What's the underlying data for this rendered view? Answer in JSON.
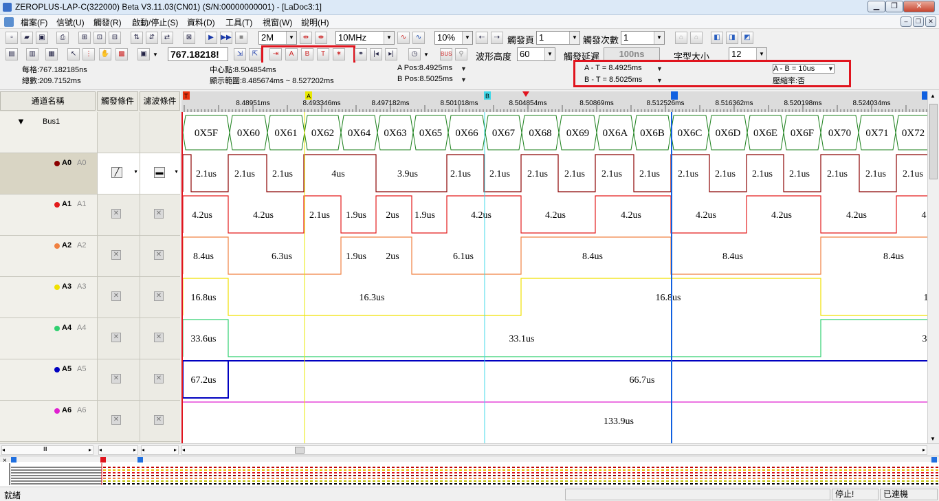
{
  "window": {
    "title": "ZEROPLUS-LAP-C(322000) Beta V3.11.03(CN01) (S/N:00000000001) - [LaDoc3:1]"
  },
  "menu": [
    "檔案(F)",
    "信號(U)",
    "觸發(R)",
    "啟動/停止(S)",
    "資料(D)",
    "工具(T)",
    "視窗(W)",
    "說明(H)"
  ],
  "toolbar": {
    "memory_depth": "2M",
    "sample_rate": "10MHz",
    "trigger_pos": "10%",
    "trigger_page_label": "觸發頁",
    "trigger_page": "1",
    "trigger_count_label": "觸發次數",
    "trigger_count": "1",
    "zoom_value": "767.18218!",
    "wave_height_label": "波形高度",
    "wave_height": "60",
    "trigger_delay_label": "觸發延遲",
    "trigger_delay": "100ns",
    "font_size_label": "字型大小",
    "font_size": "12"
  },
  "info": {
    "per_div": "每格:767.182185ns",
    "total": "總數:209.7152ms",
    "center": "中心點:8.504854ms",
    "range": "顯示範圍:8.485674ms ~ 8.527202ms",
    "a_pos": "A Pos:8.4925ms",
    "b_pos": "B Pos:8.5025ms",
    "a_minus_t": "A - T = 8.4925ms",
    "b_minus_t": "B - T = 8.5025ms",
    "a_minus_b": "A - B = 10us",
    "compress": "壓縮率:否"
  },
  "headers": {
    "channel_name": "通道名稱",
    "trigger_cond": "觸發條件",
    "filter_cond": "濾波條件"
  },
  "channels": [
    {
      "name": "Bus1",
      "alias": "",
      "color": "#000000"
    },
    {
      "name": "A0",
      "alias": "A0",
      "color": "#8b0000"
    },
    {
      "name": "A1",
      "alias": "A1",
      "color": "#e31b1b"
    },
    {
      "name": "A2",
      "alias": "A2",
      "color": "#f08040"
    },
    {
      "name": "A3",
      "alias": "A3",
      "color": "#f0e000"
    },
    {
      "name": "A4",
      "alias": "A4",
      "color": "#30d070"
    },
    {
      "name": "A5",
      "alias": "A5",
      "color": "#0000c0"
    },
    {
      "name": "A6",
      "alias": "A6",
      "color": "#e020d0"
    }
  ],
  "ruler": {
    "ticks": [
      "8.48951ms",
      "8.493346ms",
      "8.497182ms",
      "8.501018ms",
      "8.504854ms",
      "8.50869ms",
      "8.512526ms",
      "8.516362ms",
      "8.520198ms",
      "8.524034ms"
    ],
    "markers": [
      "A",
      "B"
    ]
  },
  "bus": [
    "0X5F",
    "0X60",
    "0X61",
    "0X62",
    "0X64",
    "0X63",
    "0X65",
    "0X66",
    "0X67",
    "0X68",
    "0X69",
    "0X6A",
    "0X6B",
    "0X6C",
    "0X6D",
    "0X6E",
    "0X6F",
    "0X70",
    "0X71",
    "0X72"
  ],
  "waves": [
    {
      "ch": "A0",
      "labels": [
        "2.1us",
        "2.1us",
        "2.1us",
        "4us",
        "3.9us",
        "2.1us",
        "2.1us",
        "2.1us",
        "2.1us",
        "2.1us",
        "2.1us",
        "2.1us",
        "2.1us",
        "2.1us",
        "2.1us",
        "2.1us",
        "2.1us",
        "2.1us"
      ]
    },
    {
      "ch": "A1",
      "labels": [
        "4.2us",
        "4.2us",
        "2.1us",
        "1.9us",
        "2us",
        "1.9us",
        "4.2us",
        "4.2us",
        "4.2us",
        "4.2us",
        "4.2us",
        "4.2us",
        "4"
      ]
    },
    {
      "ch": "A2",
      "labels": [
        "8.4us",
        "6.3us",
        "1.9us",
        "2us",
        "6.1us",
        "8.4us",
        "8.4us",
        "8.4us"
      ]
    },
    {
      "ch": "A3",
      "labels": [
        "16.8us",
        "16.3us",
        "16.8us",
        "1"
      ]
    },
    {
      "ch": "A4",
      "labels": [
        "33.6us",
        "33.1us",
        "3"
      ]
    },
    {
      "ch": "A5",
      "labels": [
        "67.2us",
        "66.7us"
      ]
    },
    {
      "ch": "A6",
      "labels": [
        "133.9us"
      ]
    }
  ],
  "status": {
    "ready": "就緒",
    "state": "停止!",
    "conn": "已連機"
  },
  "colors": {
    "cursorA": "#e8e800",
    "cursorB": "#40d8e8",
    "cursorT": "#1060e0",
    "highlight": "#e0141e"
  }
}
